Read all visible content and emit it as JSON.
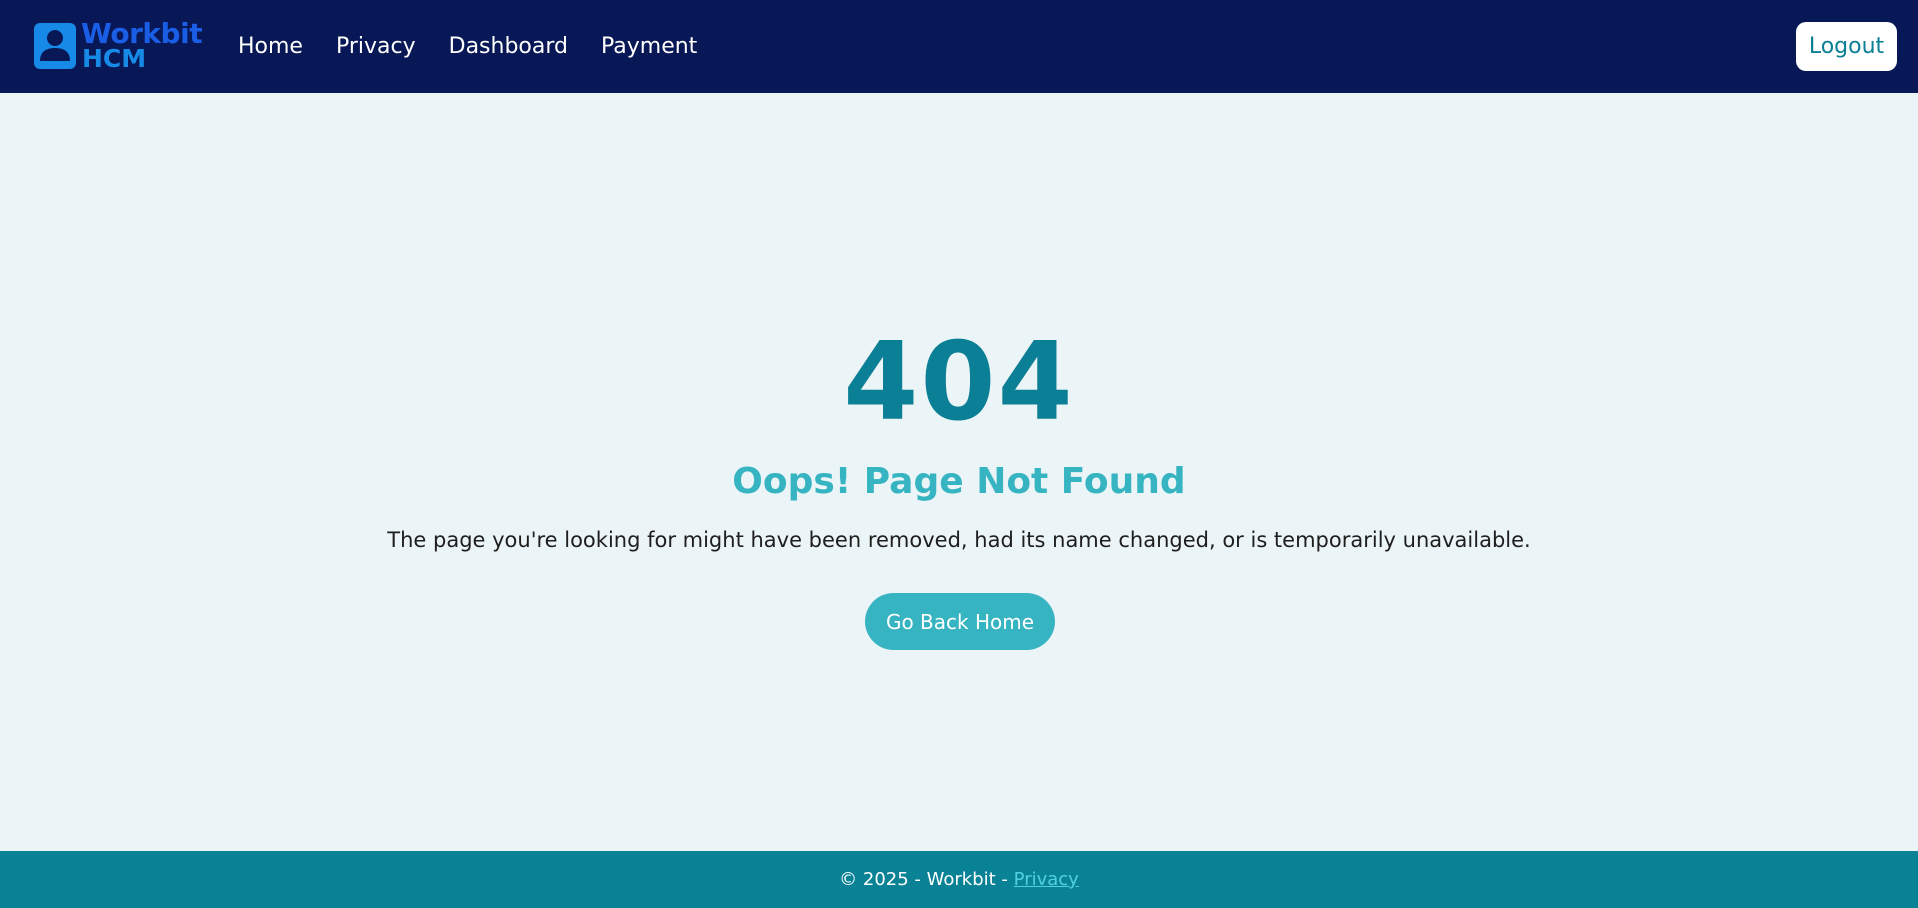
{
  "brand": {
    "line1": "Workbit",
    "line2": "HCM",
    "icon": "user-badge-icon",
    "colors": {
      "line1": "#1a5ee6",
      "line2": "#1789e6"
    }
  },
  "nav": {
    "items": [
      {
        "label": "Home"
      },
      {
        "label": "Privacy"
      },
      {
        "label": "Dashboard"
      },
      {
        "label": "Payment"
      }
    ],
    "logout_label": "Logout"
  },
  "error": {
    "code": "404",
    "title": "Oops! Page Not Found",
    "description": "The page you're looking for might have been removed, had its name changed, or is temporarily unavailable.",
    "button_label": "Go Back Home"
  },
  "footer": {
    "text": "© 2025 - Workbit - ",
    "link_label": "Privacy"
  },
  "colors": {
    "navbar_bg": "#081856",
    "page_bg": "#ebf4f7",
    "primary": "#0b7f95",
    "accent": "#36b4c1",
    "footer_bg": "#0a8296"
  }
}
